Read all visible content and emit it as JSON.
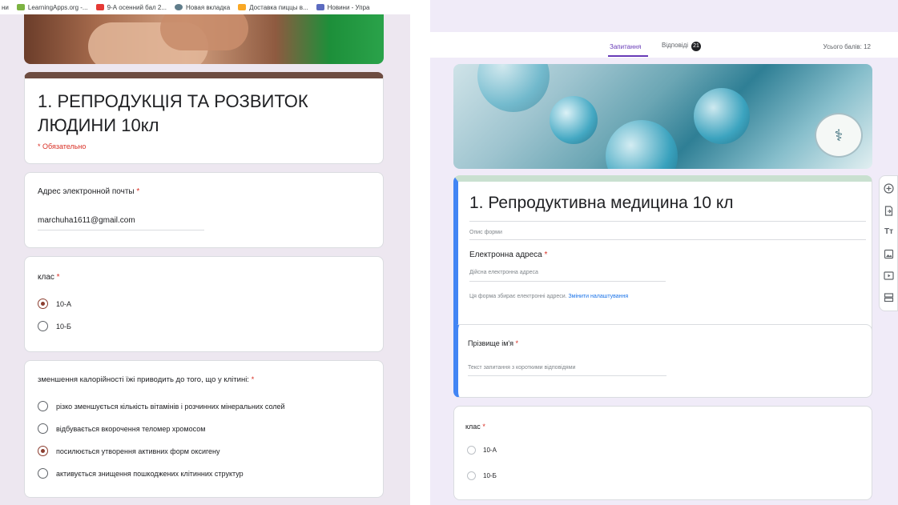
{
  "left": {
    "bookmarks": [
      {
        "label": "ни",
        "icon": "text",
        "color": "#ffffff"
      },
      {
        "label": "LearningApps.org -...",
        "icon": "learningapps-icon",
        "color": "#7cb342"
      },
      {
        "label": "9-А осенний бал 2...",
        "icon": "youtube-icon",
        "color": "#e53935"
      },
      {
        "label": "Новая вкладка",
        "icon": "globe-icon",
        "color": "#607d8b"
      },
      {
        "label": "Доставка пиццы в...",
        "icon": "pizza-icon",
        "color": "#f9a825"
      },
      {
        "label": "Новини - Упра",
        "icon": "news-icon",
        "color": "#5c6bc0"
      }
    ],
    "form_title": "1. РЕПРОДУКЦІЯ ТА РОЗВИТОК ЛЮДИНИ 10кл",
    "required_note": "* Обязательно",
    "email": {
      "label": "Адрес электронной почты",
      "value": "marchuha1611@gmail.com"
    },
    "class_question": {
      "label": "клас",
      "options": [
        {
          "label": "10-А",
          "checked": true
        },
        {
          "label": "10-Б",
          "checked": false
        }
      ]
    },
    "calorie_question": {
      "label": "зменшення калорійності їжі приводить до того, що у клітині:",
      "options": [
        {
          "label": "різко зменшується кількість вітамінів і розчинних мінеральних солей",
          "checked": false
        },
        {
          "label": "відбувається вкорочення теломер хромосом",
          "checked": false
        },
        {
          "label": "посилюється утворення активних форм оксигену",
          "checked": true
        },
        {
          "label": "активується знищення пошкоджених клітинних структур",
          "checked": false
        }
      ]
    },
    "star": "*"
  },
  "right": {
    "tabs": {
      "questions": "Запитання",
      "responses": "Відповіді",
      "responses_count": "21",
      "total_points": "Усього балів: 12"
    },
    "form_title": "1. Репродуктивна медицина 10 кл",
    "form_description": "Опис форми",
    "email": {
      "label": "Електронна адреса",
      "placeholder": "Дійсна електронна адреса",
      "note": "Ця форма збирає електронні адреси.",
      "change_link": "Змінити налаштування"
    },
    "name_question": {
      "label": "Прізвище ім'я",
      "placeholder": "Текст запитання з короткими відповідями"
    },
    "class_question": {
      "label": "клас",
      "options": [
        "10-А",
        "10-Б"
      ]
    },
    "toolbar_icons": [
      "add-question-icon",
      "import-questions-icon",
      "add-title-icon",
      "add-image-icon",
      "add-video-icon",
      "add-section-icon"
    ],
    "toolbar_title_glyph": "Tт",
    "accent": "#673ab7",
    "active_border": "#4285f4"
  }
}
